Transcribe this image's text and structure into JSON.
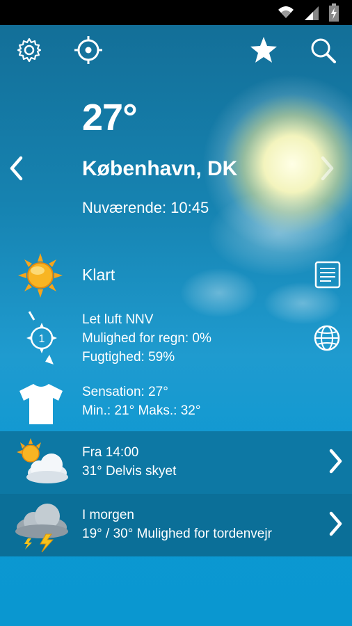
{
  "header": {
    "temperature": "27°",
    "city": "København, DK",
    "current_time": "Nuværende: 10:45"
  },
  "toolbar": {
    "settings_icon": "gear-icon",
    "locate_icon": "crosshair-icon",
    "favorite_icon": "star-icon",
    "search_icon": "search-icon"
  },
  "conditions": {
    "summary": "Klart",
    "wind": "Let luft NNV",
    "rain_chance": "Mulighed for regn: 0%",
    "humidity": "Fugtighed: 59%",
    "feels_like": "Sensation: 27°",
    "min_max": "Min.: 21° Maks.: 32°",
    "wind_number": "1"
  },
  "forecast": [
    {
      "time": "Fra 14:00",
      "description": "31° Delvis skyet",
      "icon": "partly-cloudy-icon"
    },
    {
      "time": "I morgen",
      "description": "19° / 30° Mulighed for tordenvejr",
      "icon": "thunderstorm-icon"
    }
  ],
  "colors": {
    "accent": "#0a97d0",
    "band1": "#0d78a4",
    "band2": "#0b6f98",
    "sun": "#f7b21b"
  }
}
